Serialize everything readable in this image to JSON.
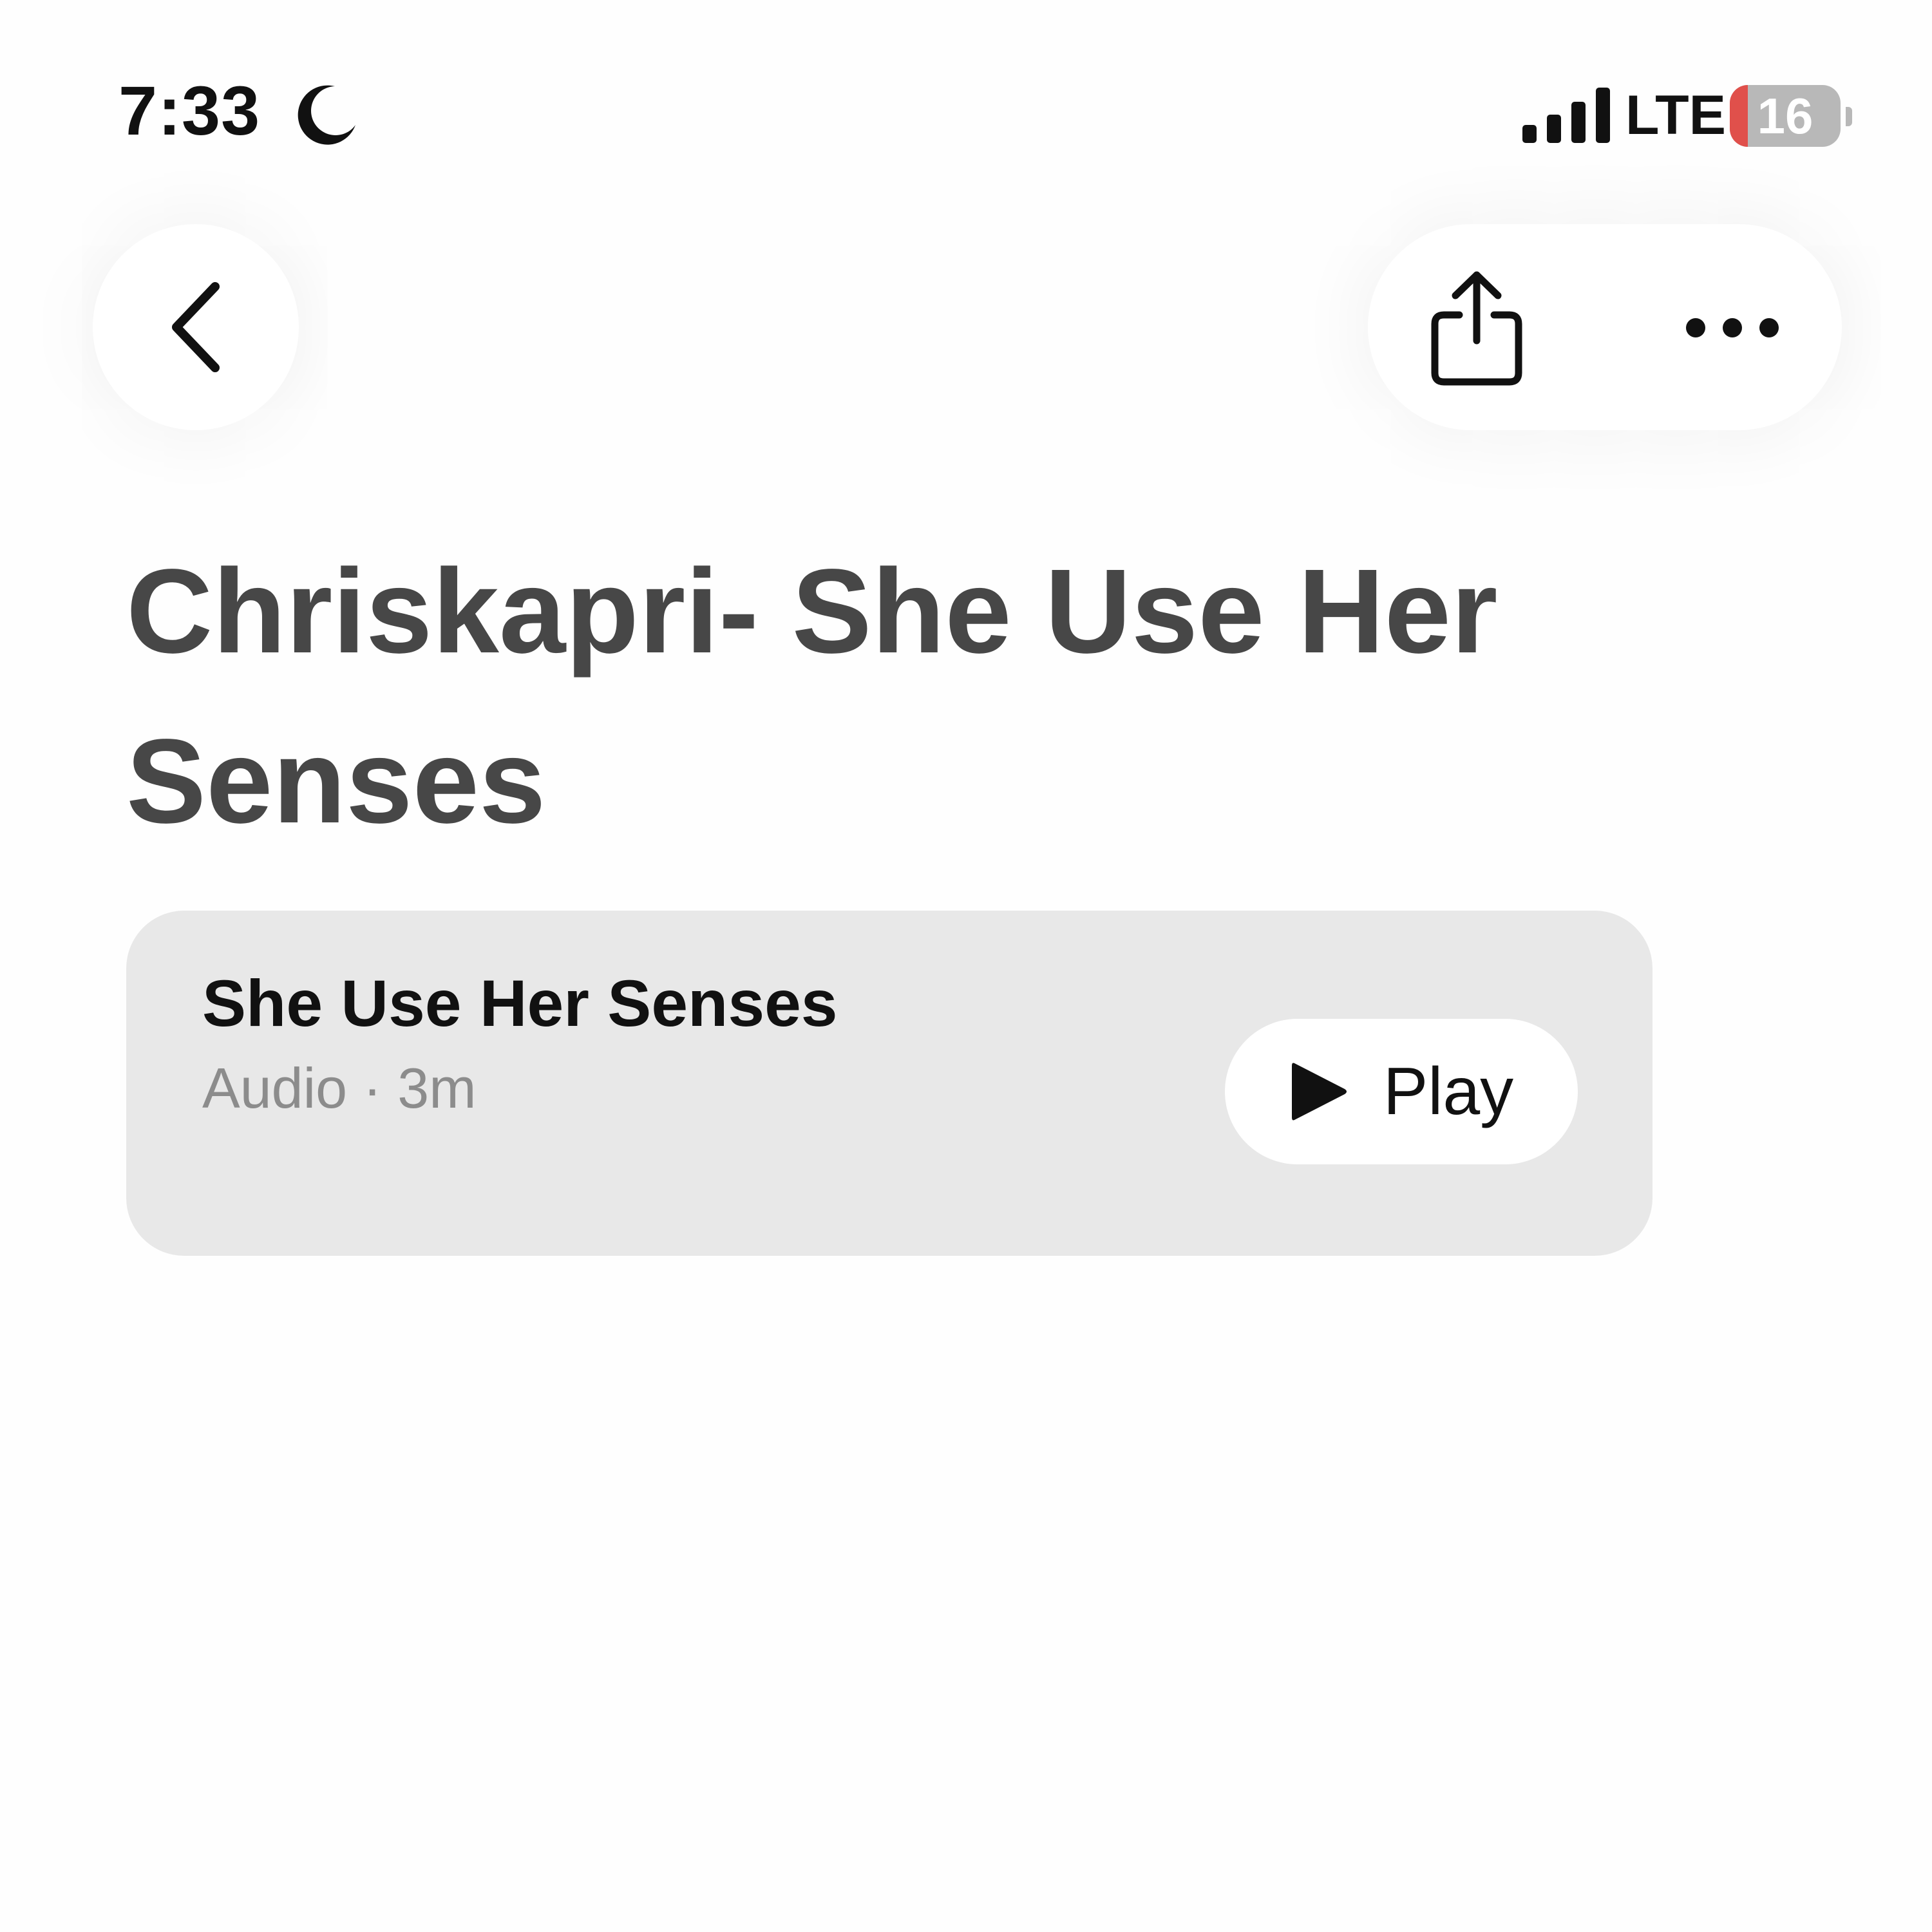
{
  "status_bar": {
    "time": "7:33",
    "focus_icon": "moon-icon",
    "signal_icon": "cellular-signal-icon",
    "network": "LTE",
    "battery_level": "16",
    "battery_percent": 16,
    "battery_color": "#e0504b"
  },
  "nav": {
    "back_icon": "chevron-left-icon",
    "share_icon": "share-icon",
    "more_icon": "ellipsis-icon"
  },
  "page": {
    "title": "Chriskapri- She Use Her Senses"
  },
  "episode": {
    "title": "She Use Her Senses",
    "meta": "Audio · 3m",
    "play_label": "Play",
    "play_icon": "play-icon"
  }
}
